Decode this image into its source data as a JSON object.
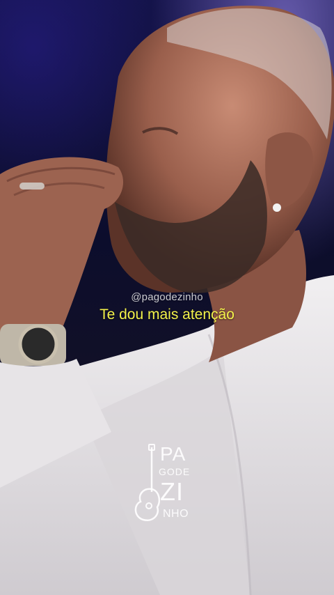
{
  "overlay": {
    "handle": "@pagodezinho",
    "caption": "Te dou mais atenção"
  },
  "logo": {
    "line1": "PA",
    "line2": "GODE",
    "line3": "ZI",
    "line4": "NHO",
    "icon": "guitar-icon"
  },
  "colors": {
    "caption": "#f3f24a",
    "background": "#0c0d2c",
    "jacket": "#e2e0e2"
  }
}
